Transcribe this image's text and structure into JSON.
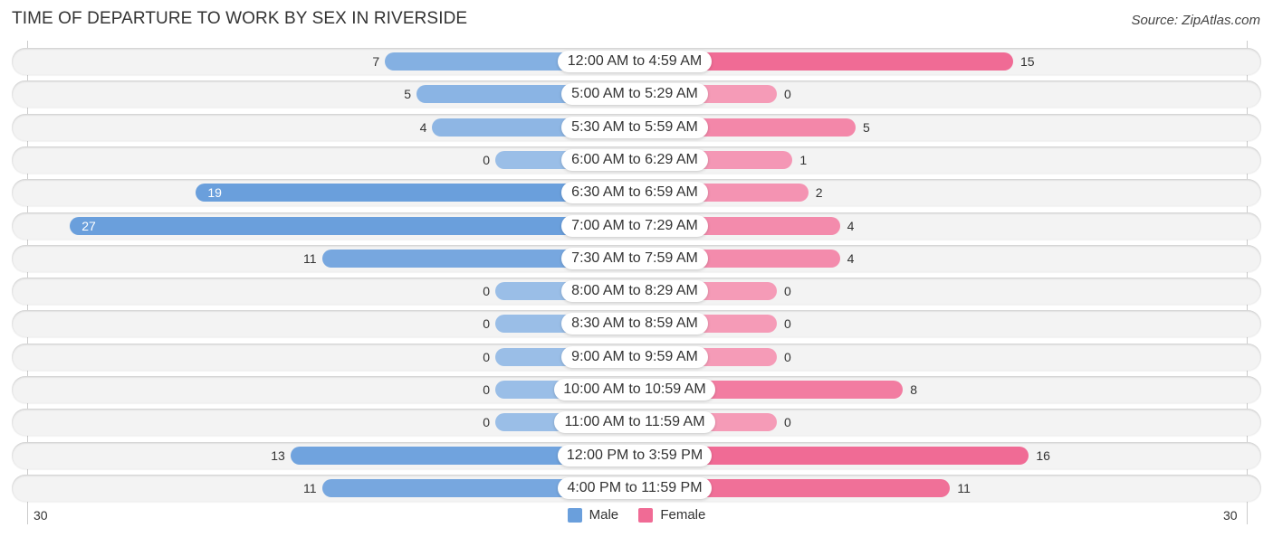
{
  "title": "TIME OF DEPARTURE TO WORK BY SEX IN RIVERSIDE",
  "source": "Source: ZipAtlas.com",
  "chart_data": {
    "type": "bar",
    "orientation": "horizontal-diverging",
    "title": "TIME OF DEPARTURE TO WORK BY SEX IN RIVERSIDE",
    "categories": [
      "12:00 AM to 4:59 AM",
      "5:00 AM to 5:29 AM",
      "5:30 AM to 5:59 AM",
      "6:00 AM to 6:29 AM",
      "6:30 AM to 6:59 AM",
      "7:00 AM to 7:29 AM",
      "7:30 AM to 7:59 AM",
      "8:00 AM to 8:29 AM",
      "8:30 AM to 8:59 AM",
      "9:00 AM to 9:59 AM",
      "10:00 AM to 10:59 AM",
      "11:00 AM to 11:59 AM",
      "12:00 PM to 3:59 PM",
      "4:00 PM to 11:59 PM"
    ],
    "series": [
      {
        "name": "Male",
        "color": "#6a9fdc",
        "values": [
          7,
          5,
          4,
          0,
          19,
          27,
          11,
          0,
          0,
          0,
          0,
          0,
          13,
          11
        ]
      },
      {
        "name": "Female",
        "color": "#f06b95",
        "values": [
          15,
          0,
          5,
          1,
          2,
          4,
          4,
          0,
          0,
          0,
          8,
          0,
          16,
          11
        ]
      }
    ],
    "axis": {
      "min_label": "30",
      "max_label": "30",
      "range": [
        0,
        30
      ]
    },
    "legend": {
      "position": "bottom-center",
      "entries": [
        "Male",
        "Female"
      ]
    }
  }
}
